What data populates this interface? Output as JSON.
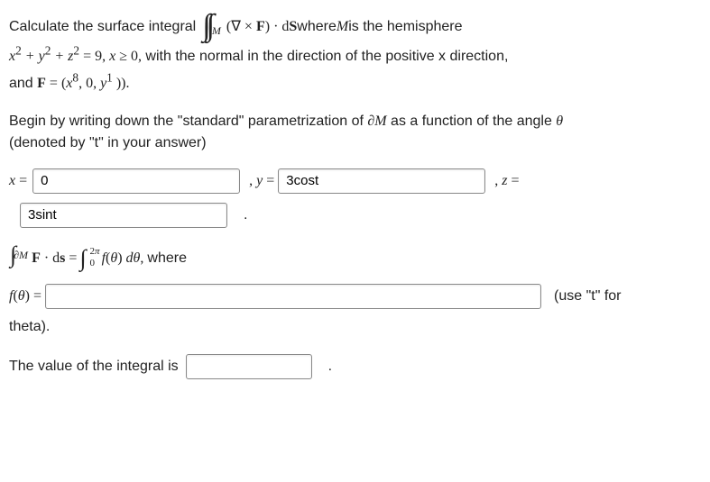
{
  "intro": {
    "lead": "Calculate the surface integral",
    "integrand": "(∇ × F) · dS",
    "tail1": " where ",
    "M": "M",
    "tail2": " is the hemisphere"
  },
  "line2": {
    "eq": "x² + y² + z² = 9, x ≥ 0,",
    "desc": " with the normal in the direction of the positive x direction,"
  },
  "line3": {
    "lead": "and ",
    "F": "F",
    "eq": " = (x⁸, 0, y¹ )).",
    "eq_plain": " = (",
    "term1": "x",
    "exp1": "8",
    "mid": ", 0, ",
    "term2": "y",
    "exp2": "1",
    "close": " ))."
  },
  "para2": {
    "a": "Begin by writing down the \"standard\" parametrization of ",
    "dM": "∂M",
    "b": " as a function of the angle ",
    "theta": "θ",
    "c": "(denoted by \"t\" in your answer)"
  },
  "inputs": {
    "x_label": "x =",
    "x_value": "0",
    "y_label": ", y =",
    "y_value": "3cost",
    "z_label": ", z =",
    "z_value": "3sint"
  },
  "stokes": {
    "lhs_pre": "∫",
    "lhs_sub": "∂M",
    "lhs_body": " F · ds = ",
    "rhs_int": "∫",
    "rhs_lo": "0",
    "rhs_hi": "2π",
    "rhs_body": " f(θ) dθ,",
    "tail": " where"
  },
  "ftheta": {
    "label": "f(θ) =",
    "value": "",
    "hint": "(use \"t\" for",
    "hint2": "theta)."
  },
  "final": {
    "label": "The value of the integral is",
    "value": "",
    "period": "."
  }
}
